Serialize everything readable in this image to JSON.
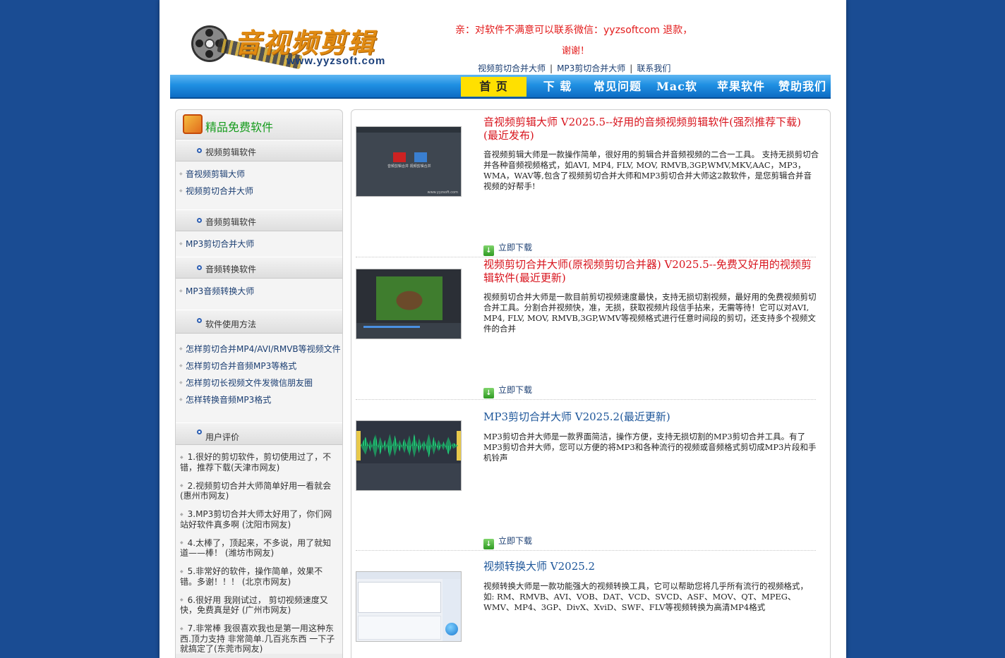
{
  "header": {
    "logo_title": "音视频剪辑",
    "logo_url": "www.yyzsoft.com",
    "notice_line1": "亲：对软件不满意可以联系微信：yyzsoftcom 退款，",
    "notice_line2": "谢谢！",
    "top_links": [
      "视频剪切合并大师",
      "MP3剪切合并大师",
      "联系我们"
    ]
  },
  "nav": {
    "items": [
      "首 页",
      "下 载",
      "常见问题",
      "Mac软件",
      "苹果软件",
      "赞助我们"
    ],
    "active_index": 0
  },
  "sidebar": {
    "title": "精品免费软件",
    "sections": [
      {
        "label": "视频剪辑软件",
        "links": [
          "音视频剪辑大师",
          "视频剪切合并大师"
        ]
      },
      {
        "label": "音频剪辑软件",
        "links": [
          "MP3剪切合并大师"
        ]
      },
      {
        "label": "音频转换软件",
        "links": [
          "MP3音频转换大师"
        ]
      },
      {
        "label": "软件使用方法",
        "links": [
          "怎样剪切合并MP4/AVI/RMVB等视频文件",
          "怎样剪切合并音频MP3等格式",
          "怎样剪切长视频文件发微信朋友圈",
          "怎样转换音频MP3格式"
        ]
      }
    ],
    "reviews_label": "用户评价",
    "reviews": [
      "1.很好的剪切软件，剪切使用过了，不错，推荐下载(天津市网友)",
      "2.视频剪切合并大师简单好用一看就会(惠州市网友)",
      "3.MP3剪切合并大师太好用了，你们网站好软件真多啊 (沈阳市网友)",
      "4.太棒了，顶起来，不多说，用了就知道——棒！ (潍坊市网友)",
      "5.非常好的软件，操作简单，效果不错。多谢！！！ (北京市网友)",
      "6.很好用 我刚试过， 剪切视频速度又快，免费真是好 (广州市网友)",
      "7.非常棒 我很喜欢我也是第一用这种东西.顶力支持 非常简单.几百兆东西 一下子就搞定了(东莞市网友)"
    ]
  },
  "products": [
    {
      "title": "音视频剪辑大师 V2025.5--好用的音频视频剪辑软件(强烈推荐下载)(最近发布)",
      "desc": "音视频剪辑大师是一款操作简单，很好用的剪辑合并音频视频的二合一工具。 支持无损剪切合并各种音频视频格式，如AVI, MP4, FLV, MOV, RMVB,3GP,WMV,MKV,AAC，MP3，WMA，WAV等,包含了视频剪切合并大师和MP3剪切合并大师这2款软件，是您剪辑合并音视频的好帮手!",
      "download": "立即下载",
      "thumb_title": "音视频剪辑大师",
      "thumb_label": "音频剪辑合并    视频剪辑合并",
      "thumb_footer": "www.yyzsoft.com"
    },
    {
      "title": "视频剪切合并大师(原视频剪切合并器) V2025.5--免费又好用的视频剪辑软件(最近更新)",
      "desc": "视频剪切合并大师是一款目前剪切视频速度最快，支持无损切割视频，最好用的免费视频剪切合并工具。分割合并视频快，准，无损，获取视频片段信手拈来，无需等待！它可以对AVI, MP4, FLV, MOV, RMVB,3GP,WMV等视频格式进行任意时间段的剪切，还支持多个视频文件的合并",
      "download": "立即下载"
    },
    {
      "title": "MP3剪切合并大师 V2025.2(最近更新)",
      "desc": "MP3剪切合并大师是一款界面简洁，操作方便，支持无损切割的MP3剪切合并工具。有了MP3剪切合并大师，您可以方便的将MP3和各种流行的视频或音频格式剪切成MP3片段和手机铃声",
      "download": "立即下载"
    },
    {
      "title": "视频转换大师 V2025.2",
      "desc": "视频转换大师是一款功能强大的视频转换工具，它可以帮助您将几乎所有流行的视频格式， 如: RM、RMVB、AVI、VOB、DAT、VCD、SVCD、ASF、MOV、QT、MPEG、WMV、MP4、3GP、DivX、XviD、SWF、FLV等视频转换为高清MP4格式"
    }
  ]
}
